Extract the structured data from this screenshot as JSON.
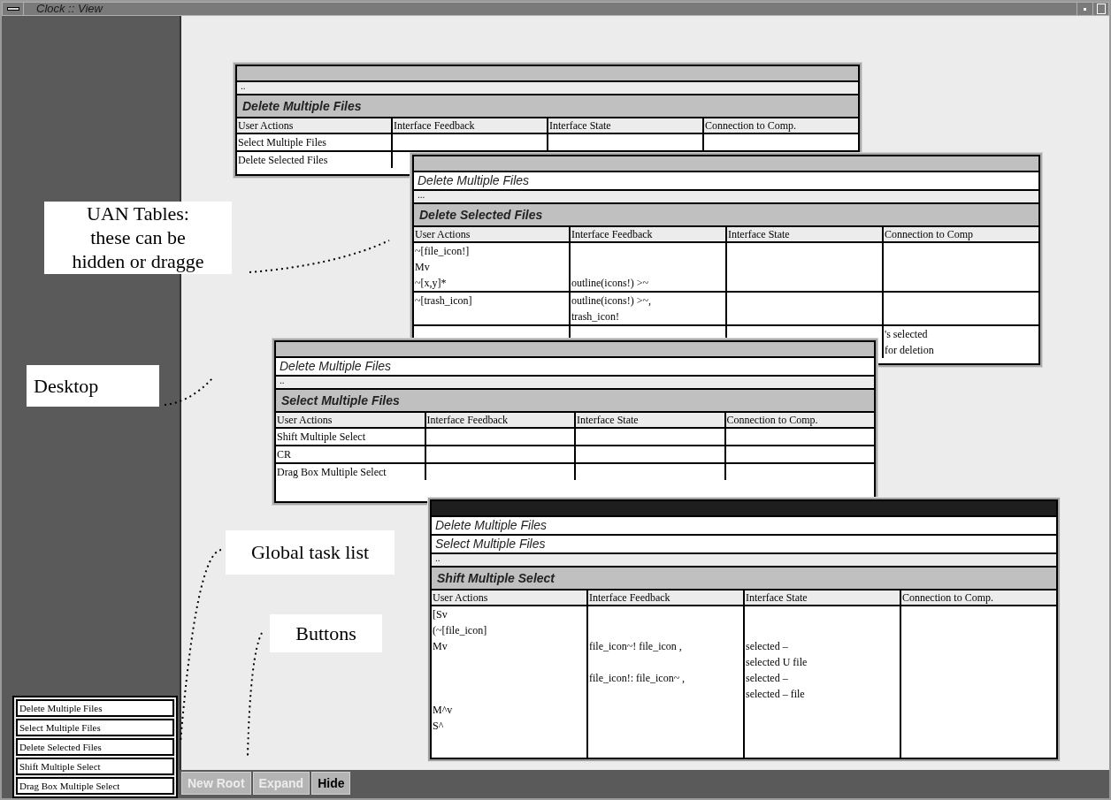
{
  "window": {
    "title": "Clock :: View"
  },
  "tables": [
    {
      "active": false,
      "ellipsis": "..",
      "title": "Delete Multiple Files",
      "columns": [
        "User Actions",
        "Interface Feedback",
        "Interface State",
        "Connection to Comp."
      ],
      "rows": [
        {
          "lines": [
            {
              "user_actions": "Select Multiple Files"
            }
          ]
        },
        {
          "lines": [
            {
              "user_actions": "Delete Selected Files"
            }
          ]
        }
      ]
    },
    {
      "active": false,
      "breadcrumbs": [
        "Delete Multiple Files"
      ],
      "ellipsis": "...",
      "title": "Delete Selected Files",
      "columns": [
        "User Actions",
        "Interface Feedback",
        "Interface State",
        "Connection to Comp"
      ],
      "rows": [
        {
          "lines": [
            {
              "user_actions": "~[file_icon!]"
            },
            {
              "user_actions": "Mv"
            },
            {
              "user_actions": "~[x,y]*",
              "interface_feedback": "outline(icons!) >~"
            }
          ]
        },
        {
          "lines": [
            {
              "user_actions": "~[trash_icon]",
              "interface_feedback": "outline(icons!) >~,"
            },
            {
              "interface_feedback": "trash_icon!"
            }
          ]
        },
        {
          "lines": [
            {
              "connection": "'s selected"
            },
            {
              "connection": "for deletion"
            }
          ]
        }
      ]
    },
    {
      "active": false,
      "breadcrumbs": [
        "Delete Multiple Files"
      ],
      "ellipsis": "..",
      "title": "Select Multiple Files",
      "columns": [
        "User Actions",
        "Interface Feedback",
        "Interface State",
        "Connection to Comp."
      ],
      "rows": [
        {
          "lines": [
            {
              "user_actions": "Shift Multiple Select"
            }
          ]
        },
        {
          "lines": [
            {
              "user_actions": "CR"
            }
          ]
        },
        {
          "lines": [
            {
              "user_actions": "Drag Box Multiple Select"
            }
          ]
        }
      ]
    },
    {
      "active": true,
      "breadcrumbs": [
        "Delete Multiple Files",
        "Select Multiple Files"
      ],
      "ellipsis": "..",
      "title": "Shift Multiple Select",
      "columns": [
        "User Actions",
        "Interface Feedback",
        "Interface State",
        "Connection to Comp."
      ],
      "rows": [
        {
          "lines": [
            {
              "user_actions": "[Sv"
            },
            {
              "user_actions": "(~[file_icon]"
            },
            {
              "user_actions": "Mv",
              "interface_feedback": "file_icon~! file_icon ,",
              "interface_state": "selected –"
            },
            {
              "interface_state": "selected U file"
            },
            {
              "interface_feedback": "file_icon!: file_icon~ ,",
              "interface_state": "selected –"
            },
            {
              "interface_state": "selected – file"
            },
            {
              "user_actions": "M^v"
            },
            {
              "user_actions": "S^"
            }
          ]
        }
      ]
    }
  ],
  "annotations": [
    {
      "lines": [
        "UAN Tables:",
        "these can be",
        "hidden or dragge"
      ]
    },
    {
      "lines": [
        "Desktop"
      ]
    },
    {
      "lines": [
        "Global task list"
      ]
    },
    {
      "lines": [
        "Buttons"
      ]
    }
  ],
  "task_list": [
    "Delete Multiple Files",
    "Select Multiple Files",
    "Delete Selected Files",
    "Shift Multiple Select",
    "Drag Box Multiple Select"
  ],
  "buttons": [
    {
      "label": "New Root",
      "disabled": true
    },
    {
      "label": "Expand",
      "disabled": true
    },
    {
      "label": "Hide",
      "disabled": false
    }
  ]
}
